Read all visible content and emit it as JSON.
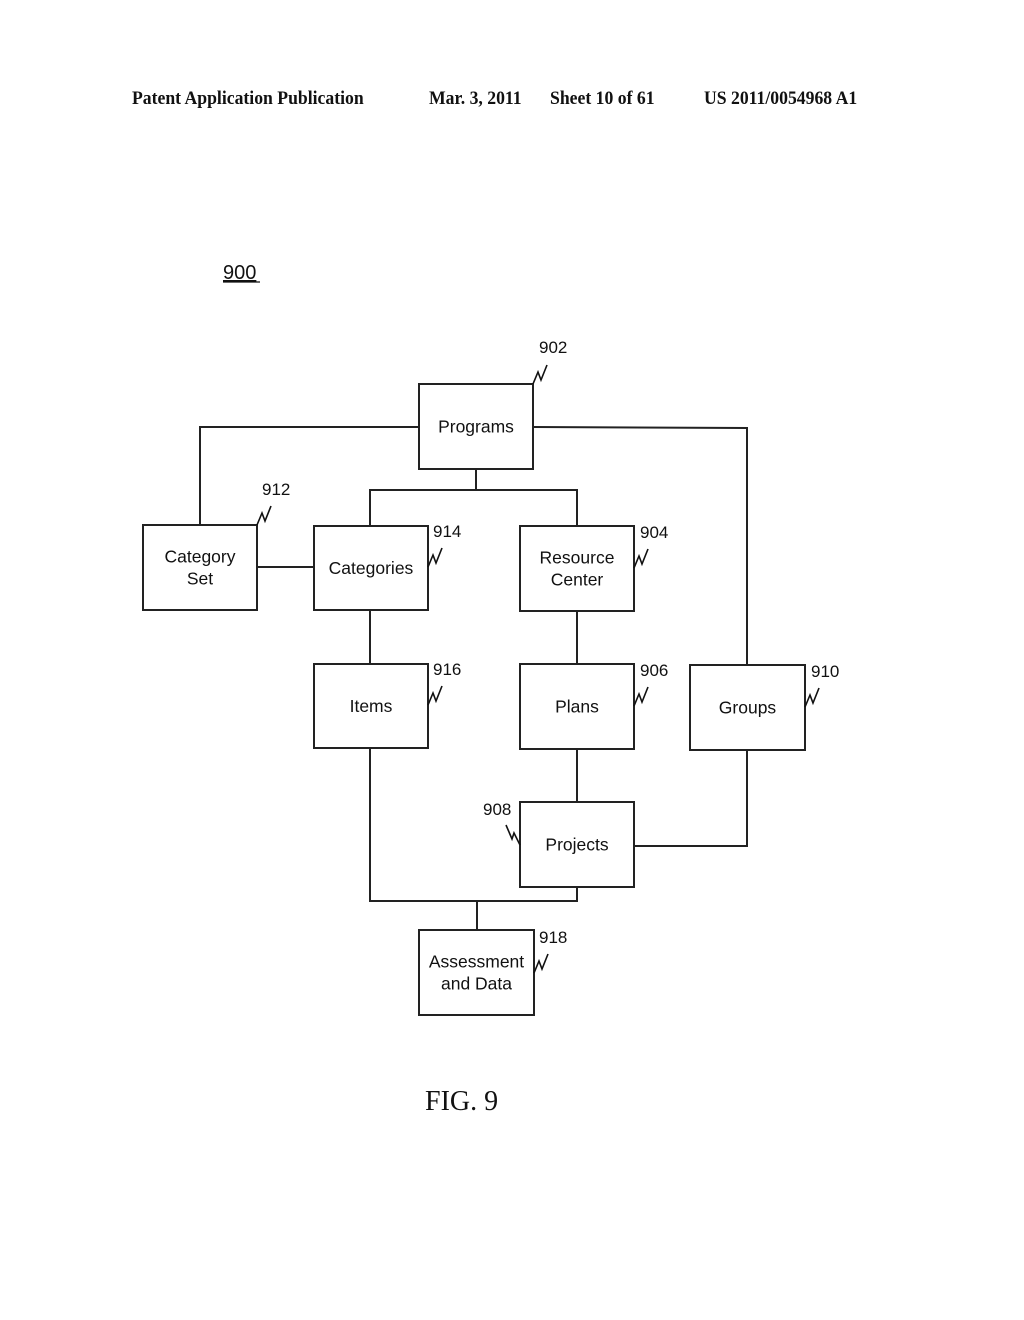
{
  "header": {
    "publication": "Patent Application Publication",
    "date": "Mar. 3, 2011",
    "sheet": "Sheet 10 of 61",
    "number": "US 2011/0054968 A1"
  },
  "figure": {
    "ref": "900",
    "caption": "FIG. 9"
  },
  "nodes": [
    {
      "id": "programs",
      "lines": [
        "Programs"
      ],
      "ref": "902"
    },
    {
      "id": "resource-center",
      "lines": [
        "Resource",
        "Center"
      ],
      "ref": "904"
    },
    {
      "id": "plans",
      "lines": [
        "Plans"
      ],
      "ref": "906"
    },
    {
      "id": "projects",
      "lines": [
        "Projects"
      ],
      "ref": "908"
    },
    {
      "id": "groups",
      "lines": [
        "Groups"
      ],
      "ref": "910"
    },
    {
      "id": "category-set",
      "lines": [
        "Category",
        "Set"
      ],
      "ref": "912"
    },
    {
      "id": "categories",
      "lines": [
        "Categories"
      ],
      "ref": "914"
    },
    {
      "id": "items",
      "lines": [
        "Items"
      ],
      "ref": "916"
    },
    {
      "id": "assessment-data",
      "lines": [
        "Assessment",
        "and Data"
      ],
      "ref": "918"
    }
  ],
  "edges": [
    {
      "from": "programs",
      "to": "category-set"
    },
    {
      "from": "programs",
      "to": "categories"
    },
    {
      "from": "programs",
      "to": "resource-center"
    },
    {
      "from": "programs",
      "to": "groups"
    },
    {
      "from": "category-set",
      "to": "categories"
    },
    {
      "from": "categories",
      "to": "items"
    },
    {
      "from": "resource-center",
      "to": "plans"
    },
    {
      "from": "plans",
      "to": "projects"
    },
    {
      "from": "groups",
      "to": "projects"
    },
    {
      "from": "items",
      "to": "assessment-data"
    },
    {
      "from": "projects",
      "to": "assessment-data"
    }
  ]
}
